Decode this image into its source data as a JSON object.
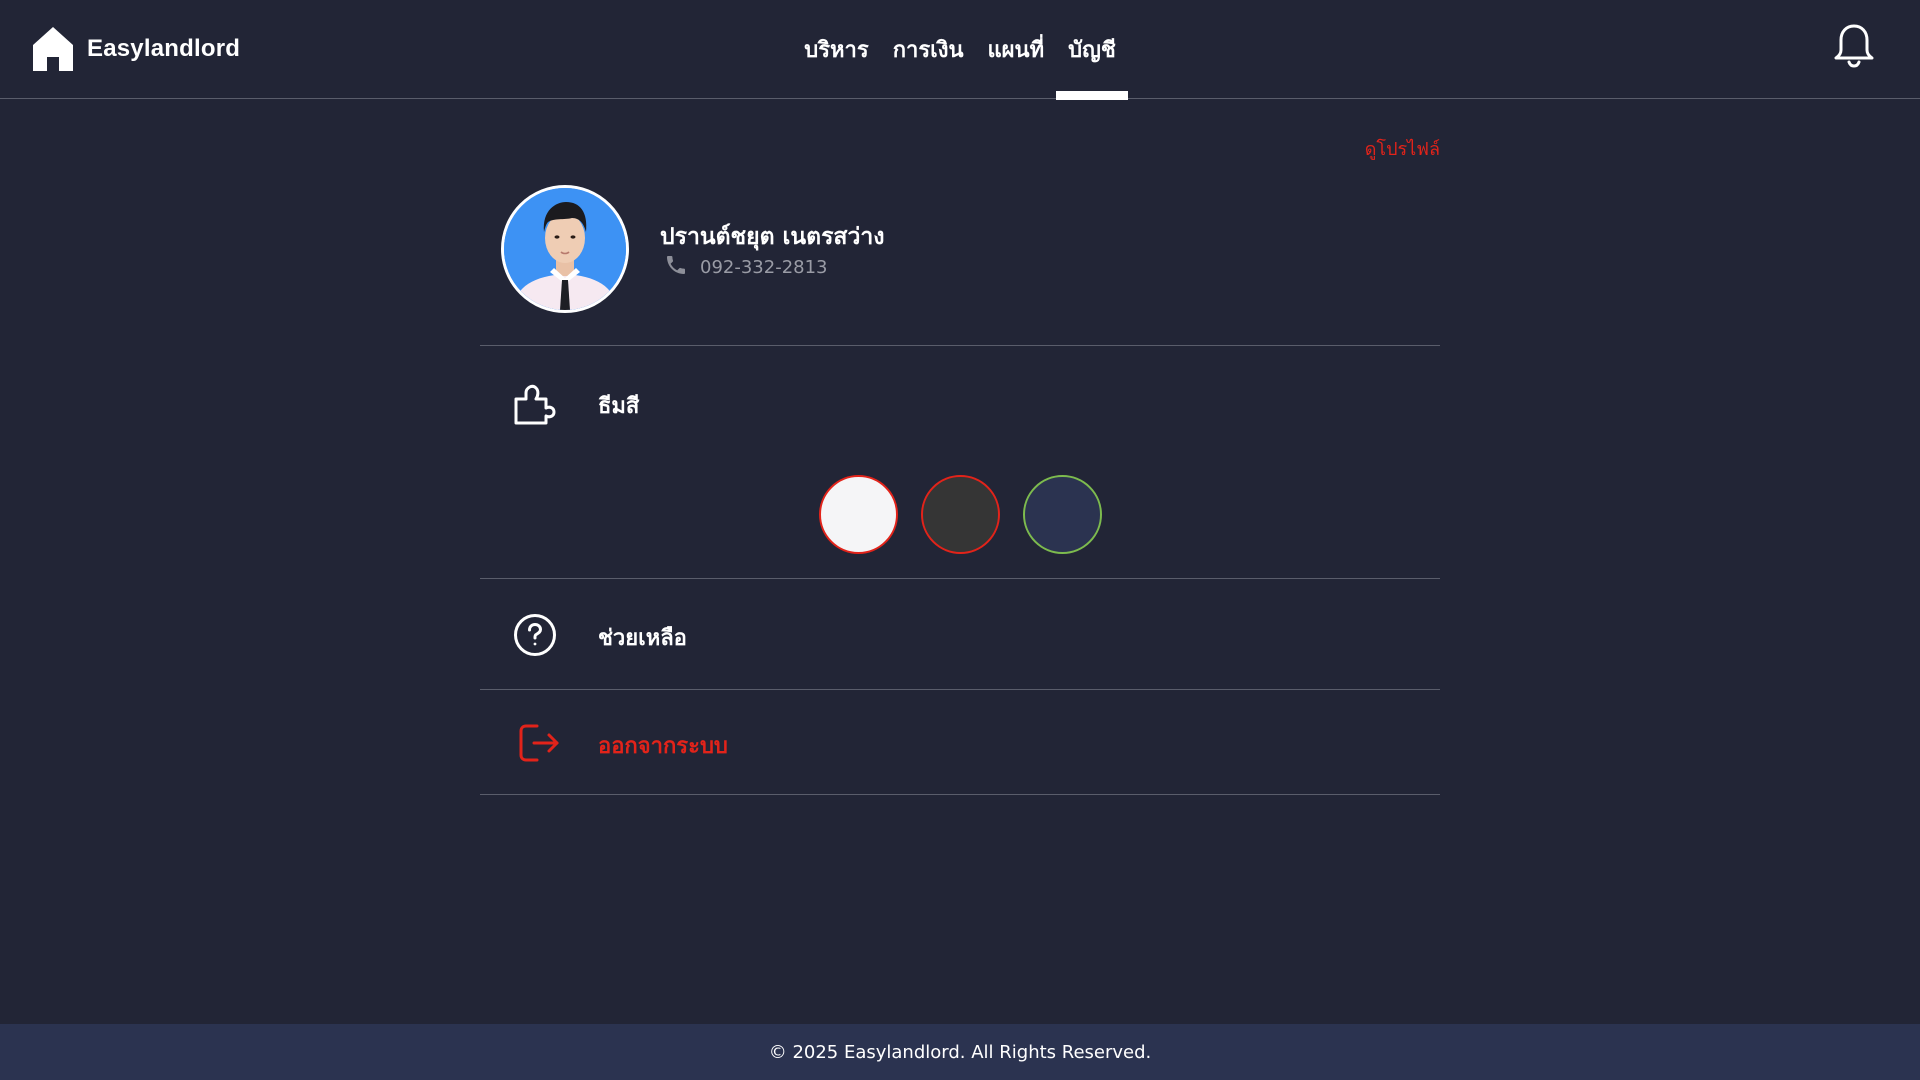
{
  "app": {
    "brand_name": "Easylandlord",
    "brand_icon": "home-icon"
  },
  "nav": {
    "tabs": [
      {
        "label": "บริหาร",
        "active": false
      },
      {
        "label": "การเงิน",
        "active": false
      },
      {
        "label": "แผนที่",
        "active": false
      },
      {
        "label": "บัญชี",
        "active": true
      }
    ],
    "notification_icon": "bell-icon"
  },
  "profile": {
    "view_profile_label": "ดูโปรไฟล์",
    "name": "ปรานต์ชยุต เนตรสว่าง",
    "phone": "092-332-2813",
    "phone_icon": "phone-icon"
  },
  "theme": {
    "label": "ธีมสี",
    "icon": "puzzle-icon",
    "options": [
      {
        "name": "light",
        "fill": "#f5f5f7",
        "border": "#e2231a"
      },
      {
        "name": "dark",
        "fill": "#353535",
        "border": "#e2231a"
      },
      {
        "name": "navy",
        "fill": "#2b3350",
        "border": "#7dbb4e"
      }
    ]
  },
  "menu": {
    "help_label": "ช่วยเหลือ",
    "help_icon": "help-circle-icon",
    "logout_label": "ออกจากระบบ",
    "logout_icon": "logout-icon",
    "logout_color": "#e2231a"
  },
  "footer": {
    "copyright": "© 2025 Easylandlord. All Rights Reserved."
  },
  "colors": {
    "background": "#222536",
    "footer_bg": "#2b3350",
    "accent_red": "#e2231a"
  }
}
